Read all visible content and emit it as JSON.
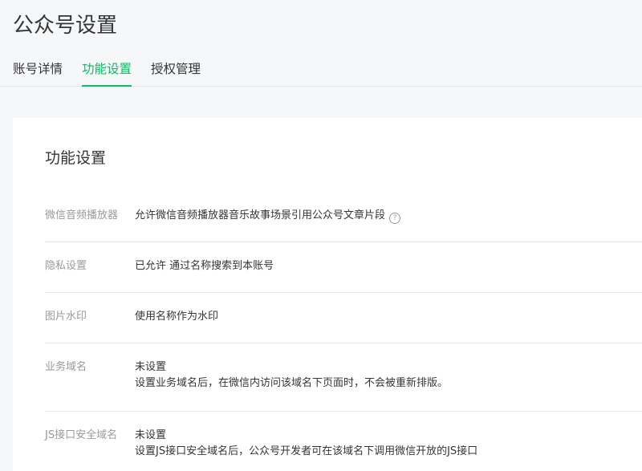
{
  "page": {
    "title": "公众号设置"
  },
  "tabs": [
    {
      "label": "账号详情",
      "active": false
    },
    {
      "label": "功能设置",
      "active": true
    },
    {
      "label": "授权管理",
      "active": false
    }
  ],
  "card": {
    "title": "功能设置",
    "rows": [
      {
        "label": "微信音频播放器",
        "lines": [
          "允许微信音频播放器音乐故事场景引用公众号文章片段"
        ],
        "help_icon": "?"
      },
      {
        "label": "隐私设置",
        "lines": [
          "已允许 通过名称搜索到本账号"
        ]
      },
      {
        "label": "图片水印",
        "lines": [
          "使用名称作为水印"
        ]
      },
      {
        "label": "业务域名",
        "lines": [
          "未设置",
          "设置业务域名后，在微信内访问该域名下页面时，不会被重新排版。"
        ]
      },
      {
        "label": "JS接口安全域名",
        "lines": [
          "未设置",
          "设置JS接口安全域名后，公众号开发者可在该域名下调用微信开放的JS接口"
        ]
      }
    ]
  },
  "colors": {
    "accent": "#07c160",
    "label": "#9a9a9a",
    "text": "#353535",
    "background": "#f6f7f9"
  }
}
